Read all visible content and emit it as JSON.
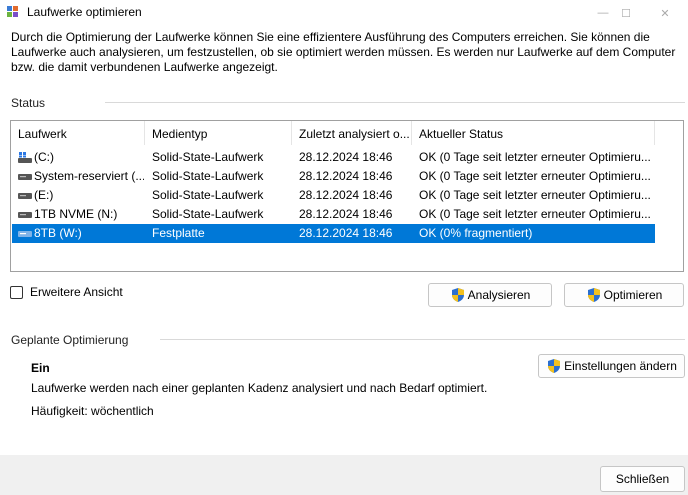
{
  "window": {
    "title": "Laufwerke optimieren",
    "controls": {
      "minimize": "—",
      "maximize": "☐",
      "close": "✕"
    }
  },
  "description": "Durch die Optimierung der Laufwerke können Sie eine effizientere Ausführung des Computers erreichen. Sie können die Laufwerke auch analysieren, um festzustellen, ob sie optimiert werden müssen. Es werden nur Laufwerke auf dem Computer bzw. die damit verbundenen Laufwerke angezeigt.",
  "status": {
    "label": "Status",
    "columns": [
      "Laufwerk",
      "Medientyp",
      "Zuletzt analysiert o...",
      "Aktueller Status"
    ],
    "rows": [
      {
        "drive": "(C:)",
        "media": "Solid-State-Laufwerk",
        "last": "28.12.2024 18:46",
        "status": "OK (0 Tage seit letzter erneuter Optimieru...",
        "icon": "windows-drive-icon",
        "selected": false
      },
      {
        "drive": "System-reserviert (...",
        "media": "Solid-State-Laufwerk",
        "last": "28.12.2024 18:46",
        "status": "OK (0 Tage seit letzter erneuter Optimieru...",
        "icon": "drive-icon",
        "selected": false
      },
      {
        "drive": "(E:)",
        "media": "Solid-State-Laufwerk",
        "last": "28.12.2024 18:46",
        "status": "OK (0 Tage seit letzter erneuter Optimieru...",
        "icon": "drive-icon",
        "selected": false
      },
      {
        "drive": "1TB NVME (N:)",
        "media": "Solid-State-Laufwerk",
        "last": "28.12.2024 18:46",
        "status": "OK (0 Tage seit letzter erneuter Optimieru...",
        "icon": "drive-icon",
        "selected": false
      },
      {
        "drive": "8TB (W:)",
        "media": "Festplatte",
        "last": "28.12.2024 18:46",
        "status": "OK (0% fragmentiert)",
        "icon": "drive-icon",
        "selected": true
      }
    ]
  },
  "advanced_view_label": "Erweitere Ansicht",
  "buttons": {
    "analyze": "Analysieren",
    "optimize": "Optimieren",
    "change_settings": "Einstellungen ändern",
    "close": "Schließen"
  },
  "scheduled": {
    "label": "Geplante Optimierung",
    "state": "Ein",
    "text": "Laufwerke werden nach einer geplanten Kadenz analysiert und nach Bedarf optimiert.",
    "frequency": "Häufigkeit: wöchentlich"
  },
  "colors": {
    "selection": "#0078d7",
    "shield_blue": "#2b6fcf",
    "shield_yellow": "#f2c01e"
  }
}
